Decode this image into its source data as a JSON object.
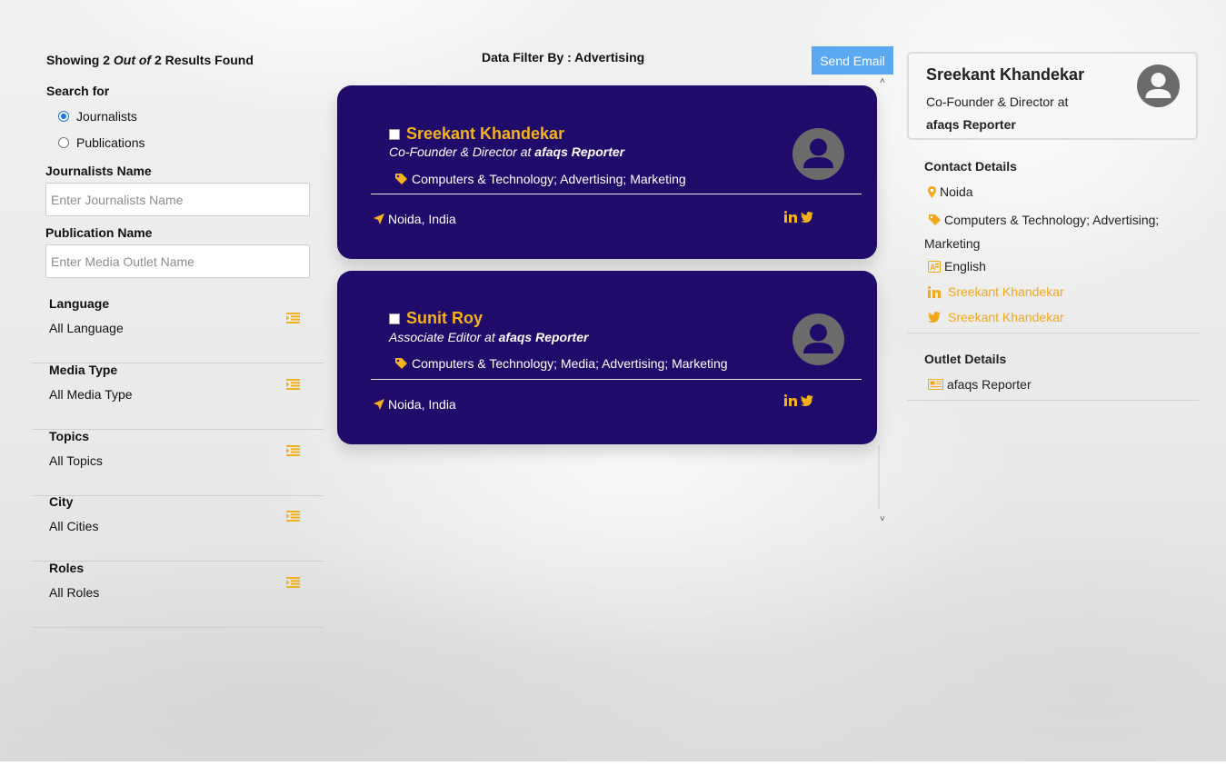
{
  "summary": {
    "prefix": "Showing 2",
    "out_of": "Out of",
    "suffix": "2 Results Found"
  },
  "search": {
    "label": "Search for",
    "options": [
      {
        "label": "Journalists",
        "selected": true
      },
      {
        "label": "Publications",
        "selected": false
      }
    ]
  },
  "journalist_name": {
    "label": "Journalists Name",
    "placeholder": "Enter Journalists Name"
  },
  "publication_name": {
    "label": "Publication Name",
    "placeholder": "Enter Media Outlet Name"
  },
  "filters": [
    {
      "title": "Language",
      "value": "All Language",
      "icon": "list-filter-icon"
    },
    {
      "title": "Media Type",
      "value": "All Media Type",
      "icon": "list-filter-icon"
    },
    {
      "title": "Topics",
      "value": "All Topics",
      "icon": "list-filter-icon"
    },
    {
      "title": "City",
      "value": "All Cities",
      "icon": "list-filter-icon"
    },
    {
      "title": "Roles",
      "value": "All Roles",
      "icon": "list-filter-icon"
    }
  ],
  "center": {
    "filter_heading": "Data Filter By : Advertising",
    "send_email": "Send Email"
  },
  "cards": [
    {
      "name": "Sreekant Khandekar",
      "role_prefix": "Co-Founder & Director at",
      "outlet": "afaqs Reporter",
      "tags": "Computers & Technology; Advertising; Marketing",
      "location": "Noida, India"
    },
    {
      "name": "Sunit Roy",
      "role_prefix": "Associate Editor at",
      "outlet": "afaqs Reporter",
      "tags": "Computers & Technology; Media; Advertising; Marketing",
      "location": "Noida, India"
    }
  ],
  "detail": {
    "name": "Sreekant Khandekar",
    "role": "Co-Founder & Director at",
    "outlet": "afaqs Reporter",
    "contact_heading": "Contact Details",
    "city": "Noida",
    "topics": "Computers & Technology; Advertising; Marketing",
    "language": "English",
    "linkedin": "Sreekant Khandekar",
    "twitter": "Sreekant Khandekar",
    "outlet_heading": "Outlet Details",
    "outlet_name": "afaqs Reporter"
  },
  "colors": {
    "card_bg": "#200a6a",
    "accent": "#f5b21b",
    "button": "#5aa8f0",
    "radio": "#1a73e8"
  }
}
